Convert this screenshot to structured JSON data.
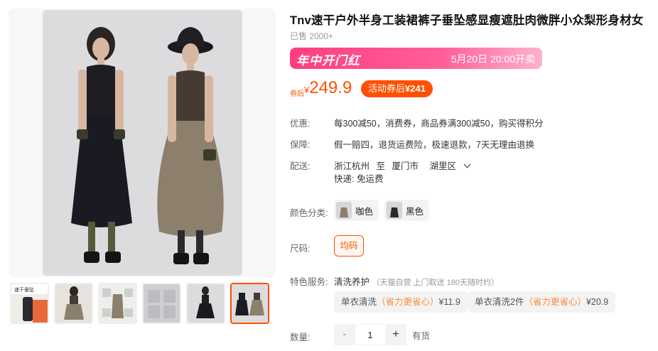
{
  "product": {
    "title": "Tnv速干户外半身工装裙裤子垂坠感显瘦遮肚肉微胖小众梨形身材女",
    "sold": "已售 2000+"
  },
  "promo": {
    "name": "年中开门红",
    "time": "5月20日 20:00开卖",
    "color_start": "#ff3d7f",
    "color_end": "#ffb2cd"
  },
  "price": {
    "coupon_tag": "券后",
    "currency": "¥",
    "value": "249.9",
    "after_coupon_prefix": "活动券后",
    "after_coupon_value": "¥241",
    "accent": "#ff5000"
  },
  "info": {
    "discount_label": "优惠:",
    "discount_value": "每300减50，消费券，商品券满300减50，购买得积分",
    "guarantee_label": "保障:",
    "guarantee_value": "假一赔四，退货运费险，极速退款，7天无理由退换",
    "shipping_label": "配送:",
    "ship_from": "浙江杭州",
    "ship_to_word": "至",
    "ship_city": "厦门市",
    "ship_district": "湖里区",
    "delivery": "快递: 免运费"
  },
  "color_options": {
    "label": "颜色分类:",
    "items": [
      {
        "name": "咖色",
        "swatch": "#8a7f6c"
      },
      {
        "name": "黑色",
        "swatch": "#2a2a2e"
      }
    ]
  },
  "size": {
    "label": "尺码:",
    "selected": "均码"
  },
  "service": {
    "label": "特色服务:",
    "name": "清洗养护",
    "note": "（天猫自营 上门取送 180天随时约）",
    "options": [
      {
        "name": "单衣清洗",
        "save": "（省力更省心）",
        "price": "¥11.9"
      },
      {
        "name": "单衣清洗2件",
        "save": "（省力更省心）",
        "price": "¥20.9"
      }
    ]
  },
  "quantity": {
    "label": "数量:",
    "minus": "-",
    "value": "1",
    "plus": "+",
    "stock": "有货"
  },
  "thumbs": [
    {
      "name": "thumb-1-promo"
    },
    {
      "name": "thumb-2-khaki"
    },
    {
      "name": "thumb-3-details"
    },
    {
      "name": "thumb-4-sizes"
    },
    {
      "name": "thumb-5-black"
    },
    {
      "name": "thumb-6-pair"
    }
  ],
  "thumb_promo_text": "速干垂坠"
}
